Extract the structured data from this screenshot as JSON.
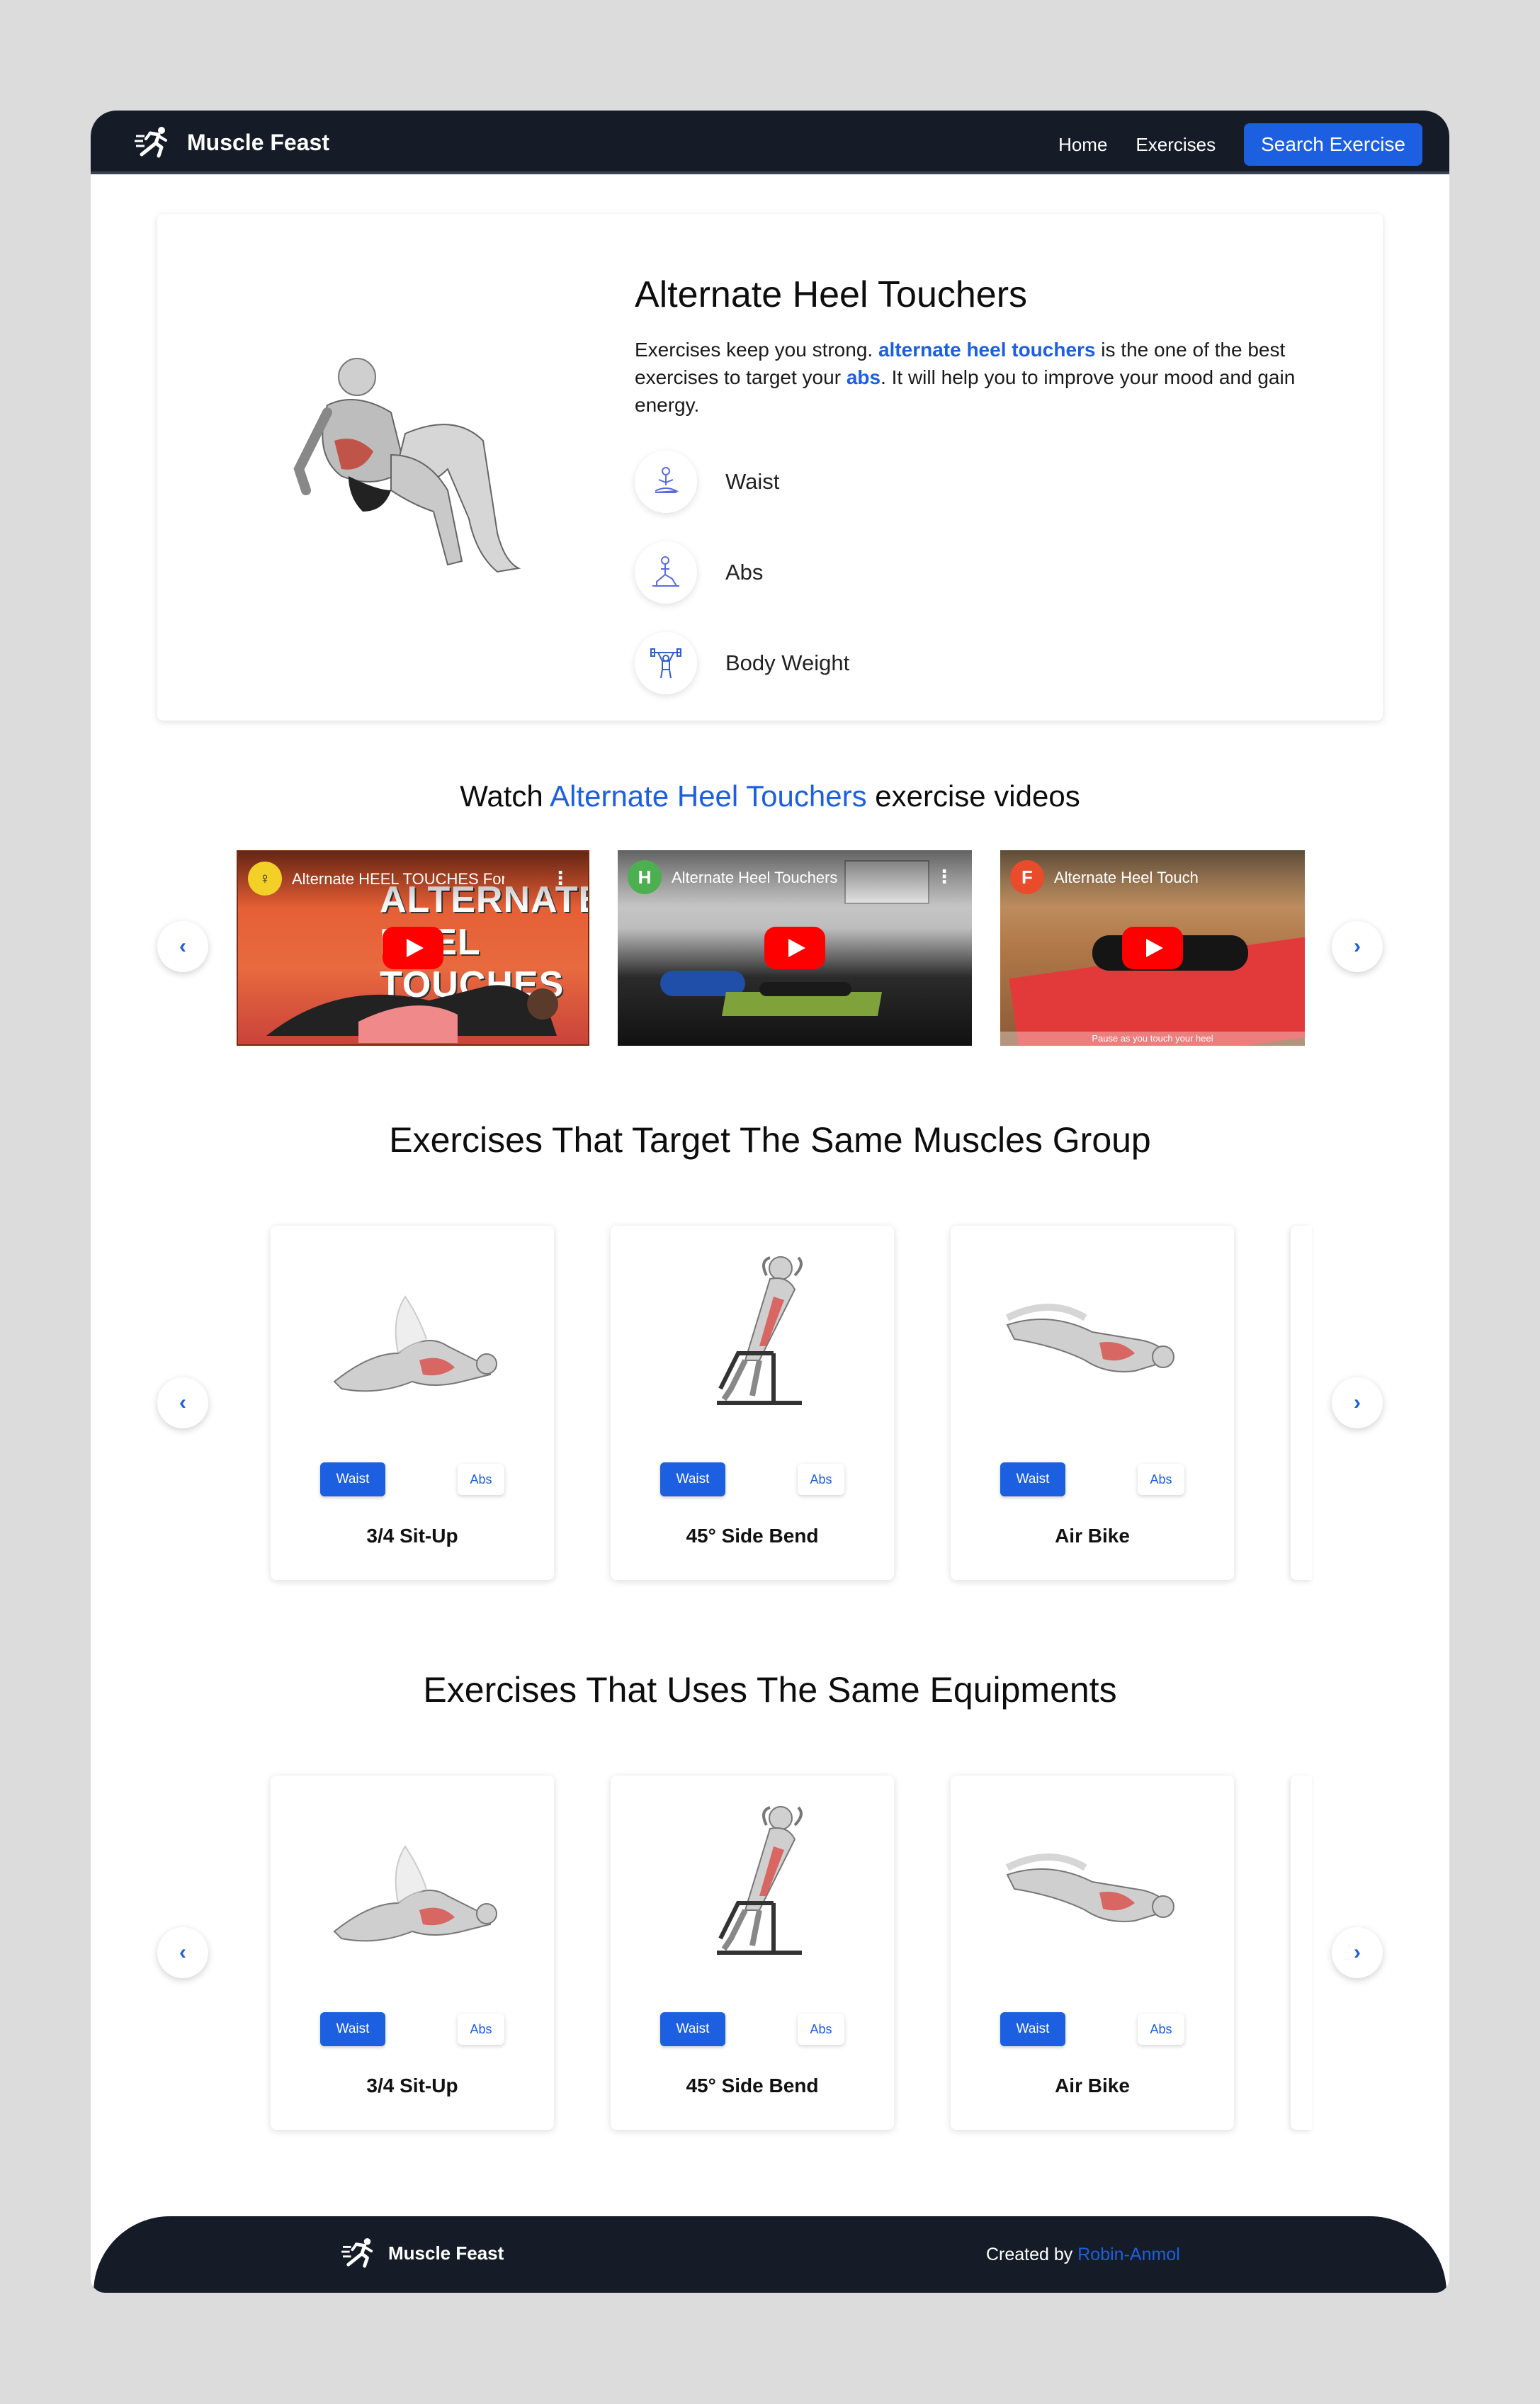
{
  "brand": {
    "name": "Muscle Feast"
  },
  "nav": {
    "home": "Home",
    "exercises": "Exercises",
    "search_button": "Search Exercise"
  },
  "hero": {
    "title": "Alternate Heel Touchers",
    "desc_part1": "Exercises keep you strong. ",
    "desc_exercise": "alternate heel touchers",
    "desc_part2": " is the one of the best exercises to target your ",
    "desc_target": "abs",
    "desc_part3": ". It will help you to improve your mood and gain energy.",
    "tags": [
      {
        "icon": "meditation-icon",
        "label": "Waist"
      },
      {
        "icon": "lunge-pose-icon",
        "label": "Abs"
      },
      {
        "icon": "weightlifter-icon",
        "label": "Body Weight"
      }
    ]
  },
  "videos_section": {
    "title_prefix": "Watch ",
    "title_name": "Alternate Heel Touchers",
    "title_suffix": " exercise videos",
    "videos": [
      {
        "channel_avatar": "",
        "title": "Alternate HEEL TOUCHES For Wo...",
        "overlay_text": "ALTERNATE HEEL TOUCHES"
      },
      {
        "channel_avatar": "H",
        "title": "Alternate Heel Touchers"
      },
      {
        "channel_avatar": "F",
        "title": "Alternate Heel Touch",
        "caption": "Pause as you touch your heel"
      }
    ]
  },
  "target_section": {
    "title": "Exercises That Target The Same Muscles Group",
    "cards": [
      {
        "name": "3/4 Sit-Up",
        "tag1": "Waist",
        "tag2": "Abs"
      },
      {
        "name": "45° Side Bend",
        "tag1": "Waist",
        "tag2": "Abs"
      },
      {
        "name": "Air Bike",
        "tag1": "Waist",
        "tag2": "Abs"
      }
    ]
  },
  "equipment_section": {
    "title": "Exercises That Uses The Same Equipments",
    "cards": [
      {
        "name": "3/4 Sit-Up",
        "tag1": "Waist",
        "tag2": "Abs"
      },
      {
        "name": "45° Side Bend",
        "tag1": "Waist",
        "tag2": "Abs"
      },
      {
        "name": "Air Bike",
        "tag1": "Waist",
        "tag2": "Abs"
      }
    ]
  },
  "arrows": {
    "left": "‹",
    "right": "›"
  },
  "footer": {
    "brand": "Muscle Feast",
    "credit_prefix": "Created by ",
    "author": "Robin-Anmol"
  },
  "colors": {
    "accent": "#1c5fe0",
    "nav_bg": "#161c27",
    "page_bg": "#dcdcdc"
  }
}
